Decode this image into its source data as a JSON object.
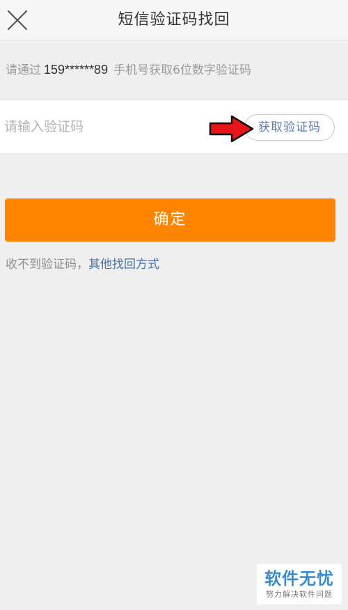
{
  "header": {
    "title": "短信验证码找回",
    "close_icon": "close-icon"
  },
  "hint": {
    "prefix": "请通过",
    "phone": "159******89",
    "suffix": "手机号获取6位数字验证码"
  },
  "code_input": {
    "placeholder": "请输入验证码",
    "value": ""
  },
  "get_code_button": {
    "label": "获取验证码"
  },
  "confirm_button": {
    "label": "确定"
  },
  "alt_recovery": {
    "prefix": "收不到验证码，",
    "link": "其他找回方式"
  },
  "watermark": {
    "main": "软件无忧",
    "sub": "努力解决软件问题"
  },
  "colors": {
    "accent": "#ff8500",
    "link": "#4a74a8",
    "annotation_arrow": "#e8141b"
  }
}
